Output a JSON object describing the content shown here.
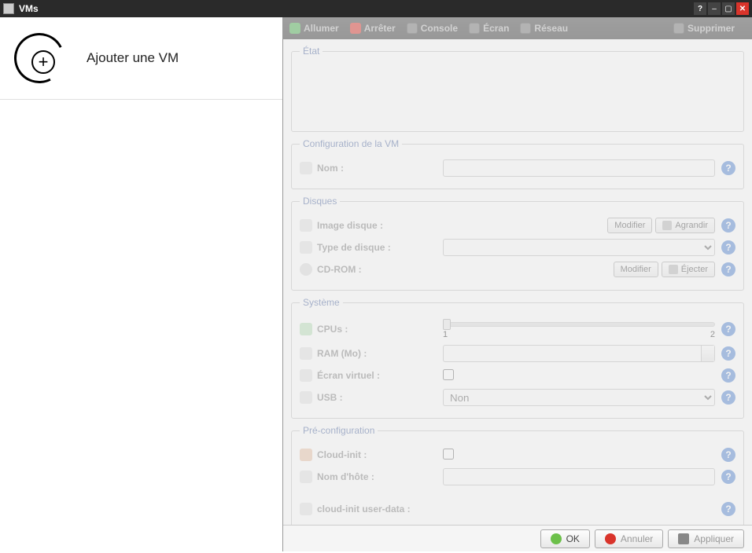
{
  "window": {
    "title": "VMs"
  },
  "sidebar": {
    "add_vm_label": "Ajouter une VM"
  },
  "toolbar": {
    "power_on": "Allumer",
    "power_off": "Arrêter",
    "console": "Console",
    "screen": "Écran",
    "network": "Réseau",
    "delete": "Supprimer"
  },
  "sections": {
    "state": {
      "legend": "État"
    },
    "config": {
      "legend": "Configuration de la VM",
      "name_label": "Nom :",
      "name_value": ""
    },
    "disks": {
      "legend": "Disques",
      "image_label": "Image disque :",
      "image_modify": "Modifier",
      "image_enlarge": "Agrandir",
      "type_label": "Type de disque :",
      "type_value": "",
      "cdrom_label": "CD-ROM :",
      "cdrom_modify": "Modifier",
      "cdrom_eject": "Éjecter"
    },
    "system": {
      "legend": "Système",
      "cpus_label": "CPUs :",
      "cpu_min": "1",
      "cpu_max": "2",
      "ram_label": "RAM (Mo) :",
      "ram_value": "",
      "vscreen_label": "Écran virtuel :",
      "vscreen_checked": false,
      "usb_label": "USB :",
      "usb_value": "Non"
    },
    "preconfig": {
      "legend": "Pré-configuration",
      "cloudinit_label": "Cloud-init :",
      "cloudinit_checked": false,
      "hostname_label": "Nom d'hôte :",
      "hostname_value": "",
      "userdata_label": "cloud-init user-data :"
    }
  },
  "buttons": {
    "ok": "OK",
    "cancel": "Annuler",
    "apply": "Appliquer"
  }
}
